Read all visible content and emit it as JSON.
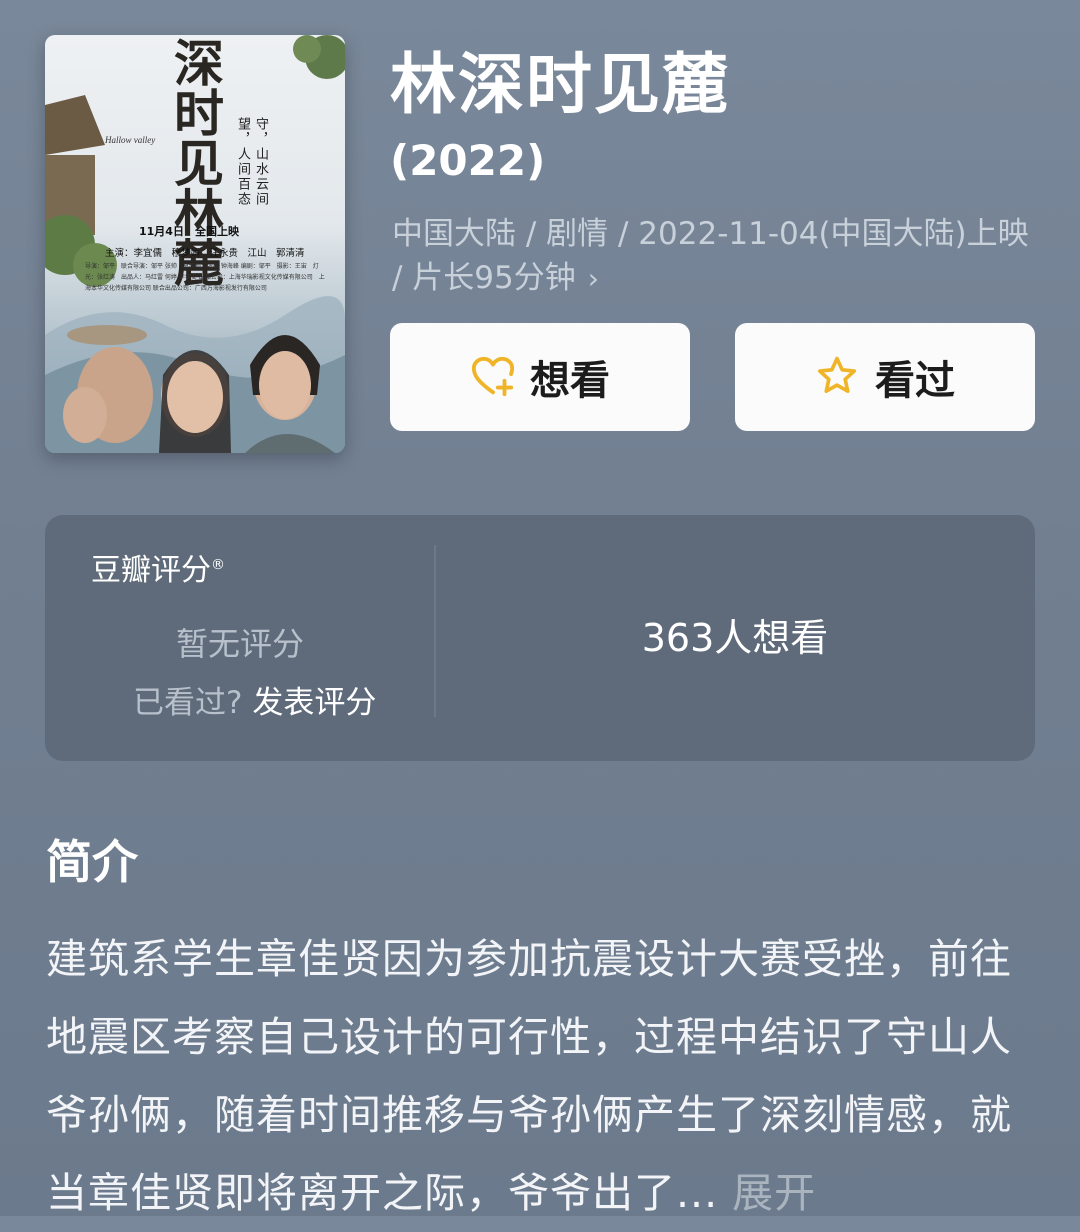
{
  "movie": {
    "title": "林深时见麓",
    "year": "(2022)",
    "meta": "中国大陆 / 剧情 / 2022-11-04(中国大陆)上映 / 片长95分钟",
    "chevron": "›"
  },
  "poster": {
    "title": "深时见林麓",
    "english": "Hallow valley",
    "tagline": "守，山水云间 望，人间百态",
    "date": "11月4日　全国上映",
    "cast": "主演：李宜儒　穆梦娇　汪永贵　江山　郭清清",
    "credits": "导演：邹平　联合导演：邹平 张帅　总策划：张权 钟海峰 编剧：邹平　摄影：王宙　灯光：张红涛　出品人：马红雷 何婷 李华安 出品公司：上海华瑞影视文化传媒有限公司　上海本华文化传媒有限公司 联合出品公司：广西万海影视发行有限公司"
  },
  "actions": {
    "want_label": "想看",
    "want_icon": "heart-plus-icon",
    "seen_label": "看过",
    "seen_icon": "star-outline-icon",
    "icon_color": "#f0b429"
  },
  "rating": {
    "brand": "豆瓣评分",
    "registered": "®",
    "no_score": "暂无评分",
    "seen_question": "已看过?",
    "post_rating": "发表评分",
    "wish_count": "363人想看"
  },
  "synopsis": {
    "heading": "简介",
    "text": "建筑系学生章佳贤因为参加抗震设计大赛受挫，前往地震区考察自己设计的可行性，过程中结识了守山人爷孙俩，随着时间推移与爷孙俩产生了深刻情感，就当章佳贤即将离开之际，爷爷出了...",
    "expand": "展开"
  }
}
